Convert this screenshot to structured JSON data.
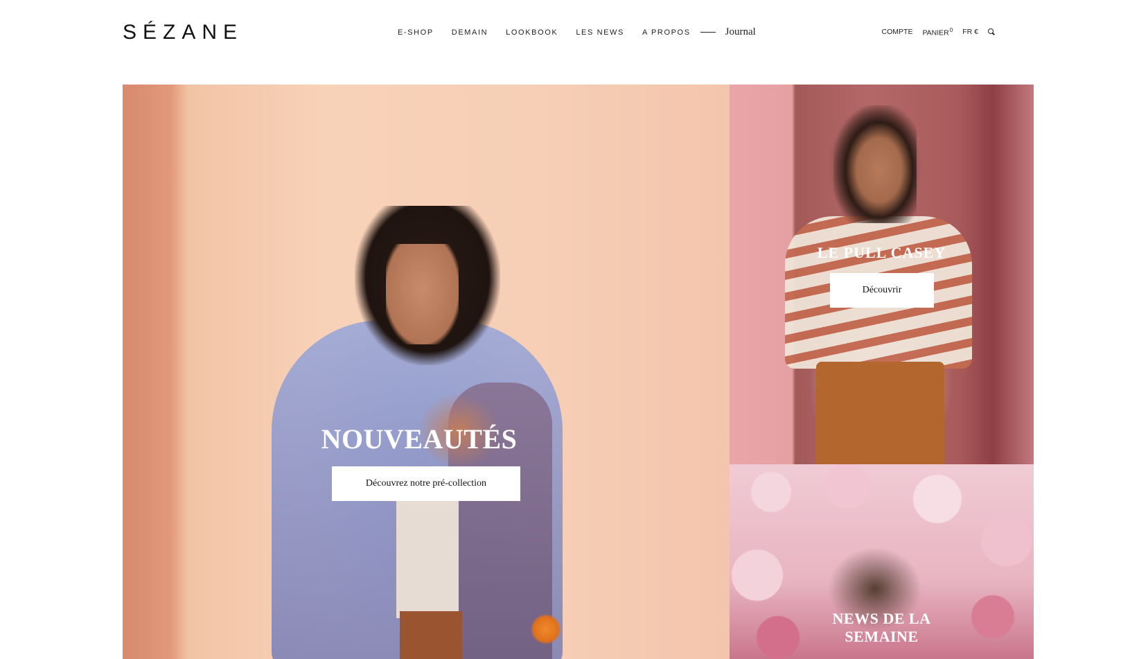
{
  "header": {
    "logo": "SÉZANE",
    "nav": [
      "E-SHOP",
      "DEMAIN",
      "LOOKBOOK",
      "LES NEWS",
      "A PROPOS"
    ],
    "journal": "Journal",
    "utility": {
      "account": "COMPTE",
      "cart": "PANIER",
      "cart_count": "0",
      "locale": "FR €",
      "search_icon": "search-icon"
    }
  },
  "tiles": {
    "main": {
      "title": "NOUVEAUTÉS",
      "cta": "Découvrez notre pré-collection"
    },
    "top_right": {
      "title": "LE PULL CASEY",
      "cta": "Découvrir"
    },
    "bottom_right": {
      "title_line1": "NEWS DE LA",
      "title_line2": "SEMAINE"
    }
  }
}
